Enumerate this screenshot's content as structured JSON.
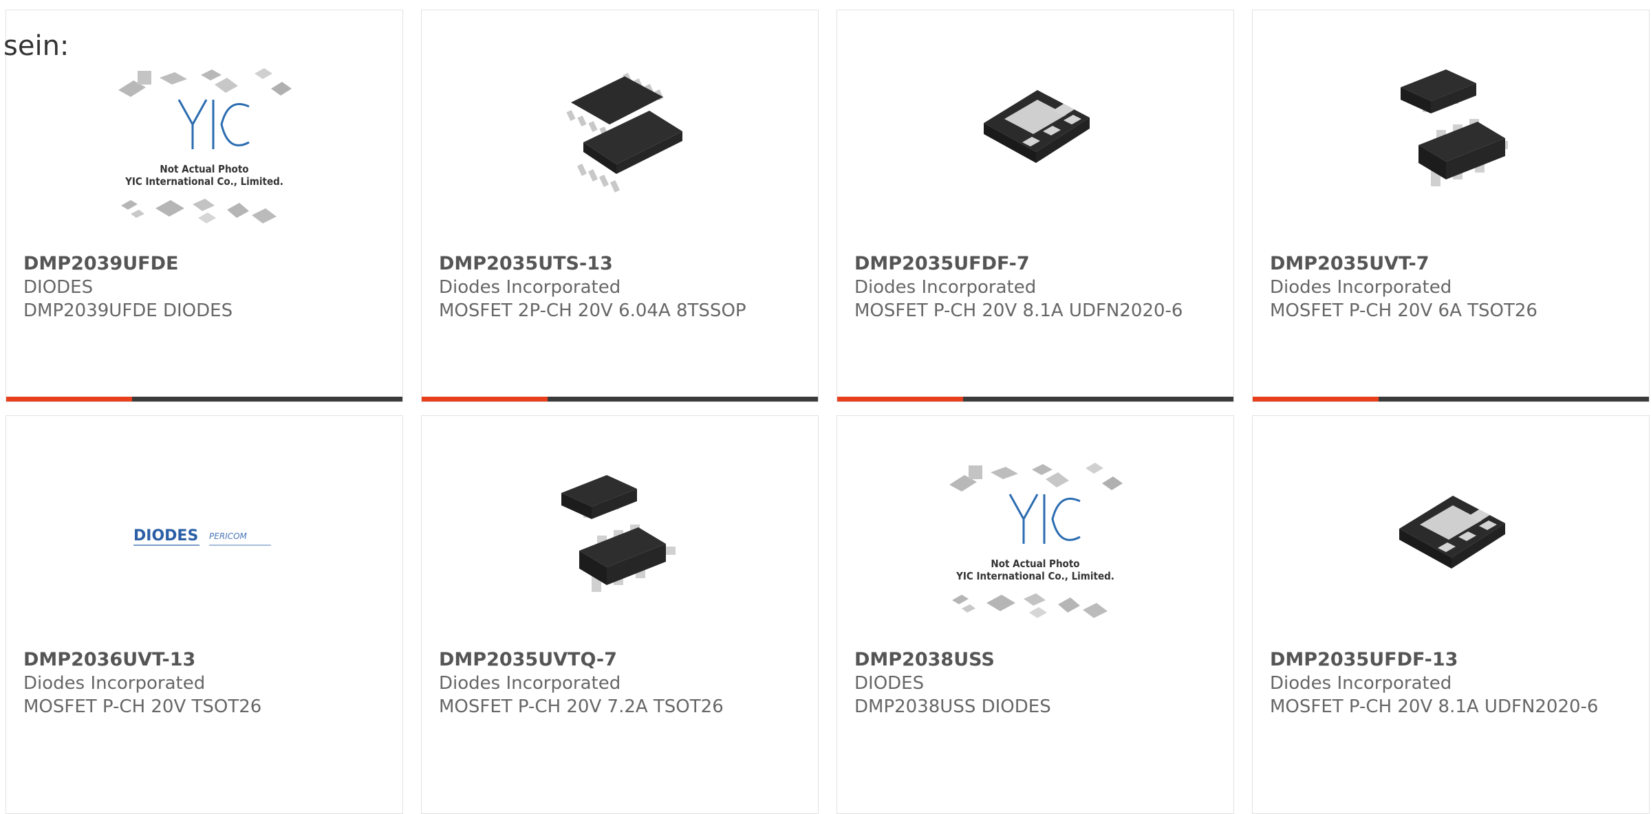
{
  "intro_text": "sein:",
  "placeholder_photo": {
    "logo": "YIC",
    "line1": "Not Actual Photo",
    "line2": "YIC International Co., Limited."
  },
  "diodes_logo": {
    "brand": "DIODES",
    "sub": "PERICOM"
  },
  "colors": {
    "accent": "#e8401c",
    "bar": "#3b3b3b",
    "text": "#555555",
    "border": "#e2e2e2"
  },
  "products": [
    {
      "part": "DMP2039UFDE",
      "manufacturer": "DIODES",
      "description": "DMP2039UFDE DIODES",
      "image": "placeholder-photo"
    },
    {
      "part": "DMP2035UTS-13",
      "manufacturer": "Diodes Incorporated",
      "description": "MOSFET 2P-CH 20V 6.04A 8TSSOP",
      "image": "tssop-chip"
    },
    {
      "part": "DMP2035UFDF-7",
      "manufacturer": "Diodes Incorporated",
      "description": "MOSFET P-CH 20V 8.1A UDFN2020-6",
      "image": "udfn-chip"
    },
    {
      "part": "DMP2035UVT-7",
      "manufacturer": "Diodes Incorporated",
      "description": "MOSFET P-CH 20V 6A TSOT26",
      "image": "tsot-chip"
    },
    {
      "part": "DMP2036UVT-13",
      "manufacturer": "Diodes Incorporated",
      "description": "MOSFET P-CH 20V TSOT26",
      "image": "diodes-logo"
    },
    {
      "part": "DMP2035UVTQ-7",
      "manufacturer": "Diodes Incorporated",
      "description": "MOSFET P-CH 20V 7.2A TSOT26",
      "image": "tsot-chip"
    },
    {
      "part": "DMP2038USS",
      "manufacturer": "DIODES",
      "description": "DMP2038USS DIODES",
      "image": "placeholder-photo"
    },
    {
      "part": "DMP2035UFDF-13",
      "manufacturer": "Diodes Incorporated",
      "description": "MOSFET P-CH 20V 8.1A UDFN2020-6",
      "image": "udfn-chip"
    }
  ]
}
